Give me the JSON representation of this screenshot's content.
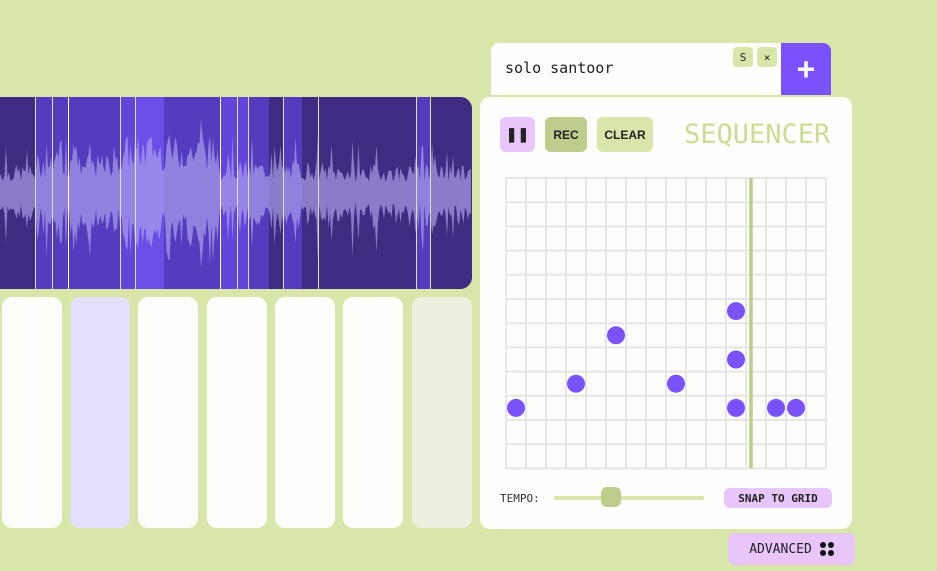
{
  "search": {
    "value": "solo santoor",
    "chip_s": "S",
    "chip_close": "×"
  },
  "add_label": "+",
  "sequencer": {
    "title": "SEQUENCER",
    "pause_label": "❚❚",
    "rec_label": "REC",
    "clear_label": "CLEAR",
    "tempo_label": "TEMPO:",
    "tempo_value": 0.38,
    "snap_label": "SNAP TO GRID",
    "columns": 16,
    "rows": 12,
    "playhead_step": 12.25,
    "notes": [
      [
        0,
        9
      ],
      [
        3,
        8
      ],
      [
        5,
        6
      ],
      [
        8,
        8
      ],
      [
        11,
        5
      ],
      [
        11,
        7
      ],
      [
        11,
        9
      ],
      [
        13,
        9
      ],
      [
        14,
        9
      ]
    ]
  },
  "advanced_label": "ADVANCED",
  "swap_icon": "⇆",
  "colors": {
    "accent": "#7a52fb",
    "bg": "#d8e6a9",
    "pink": "#e8c6fb"
  }
}
